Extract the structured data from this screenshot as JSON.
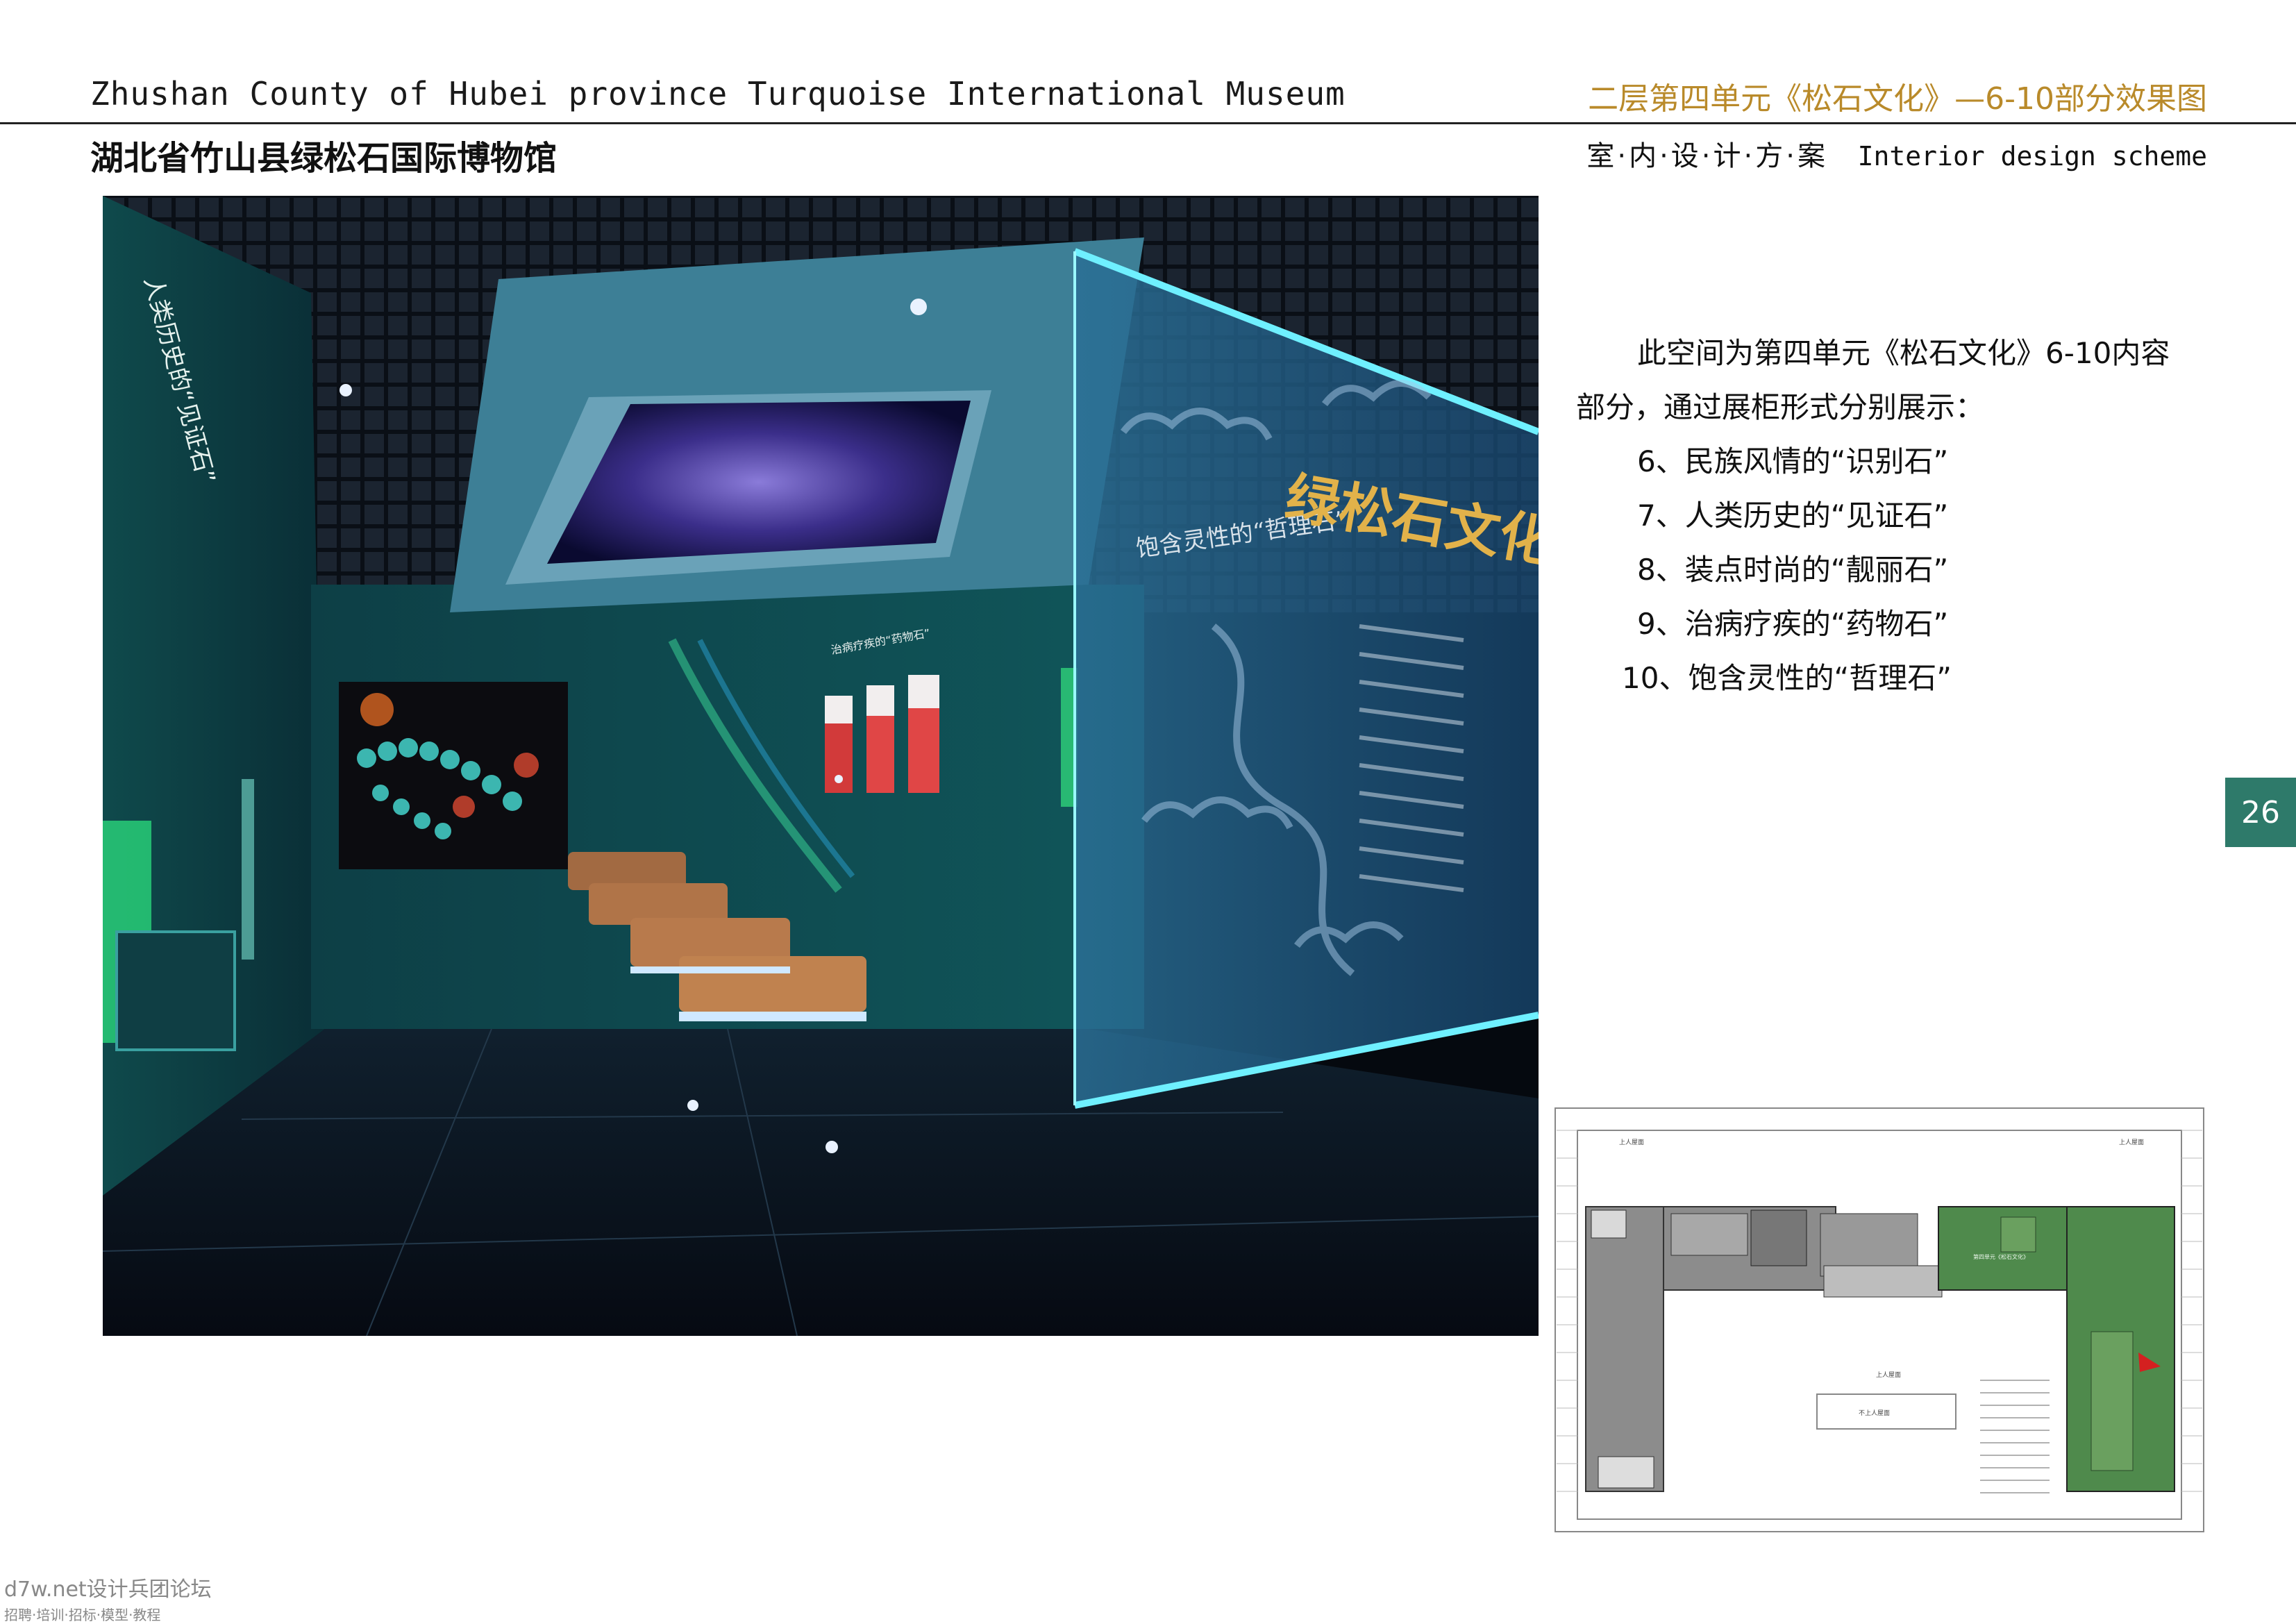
{
  "header": {
    "title_en": "Zhushan County of Hubei province Turquoise International Museum",
    "section_title": "二层第四单元《松石文化》—6-10部分效果图",
    "title_cn": "湖北省竹山县绿松石国际博物馆",
    "scheme_cn": "室·内·设·计·方·案",
    "scheme_en": "Interior design scheme"
  },
  "rendering": {
    "wall_sign_left": "人类历史的“见证石”",
    "glass_panel_title": "绿松石文化",
    "glass_panel_caption": "饱含灵性的“哲理石”",
    "back_wall_sign": "治病疗疾的“药物石”"
  },
  "description": {
    "intro": "此空间为第四单元《松石文化》6-10内容部分，通过展柜形式分别展示：",
    "items": [
      "6、民族风情的“识别石”",
      "7、人类历史的“见证石”",
      "8、装点时尚的“靓丽石”",
      "9、治病疗疾的“药物石”",
      "10、饱含灵性的“哲理石”"
    ]
  },
  "page_number": "26",
  "floor_plan": {
    "label_top_left": "上人屋面",
    "label_top_right": "上人屋面",
    "label_center": "上人屋面",
    "label_bottom_center": "不上人屋面",
    "unit_label": "第四单元《松石文化》"
  },
  "watermark": {
    "line1": "d7w.net设计兵团论坛",
    "line2": "招聘·培训·招标·模型·教程"
  },
  "colors": {
    "section_title": "#b98a2a",
    "page_tab": "#2e7a6a",
    "plan_green": "#4f8a4c"
  }
}
